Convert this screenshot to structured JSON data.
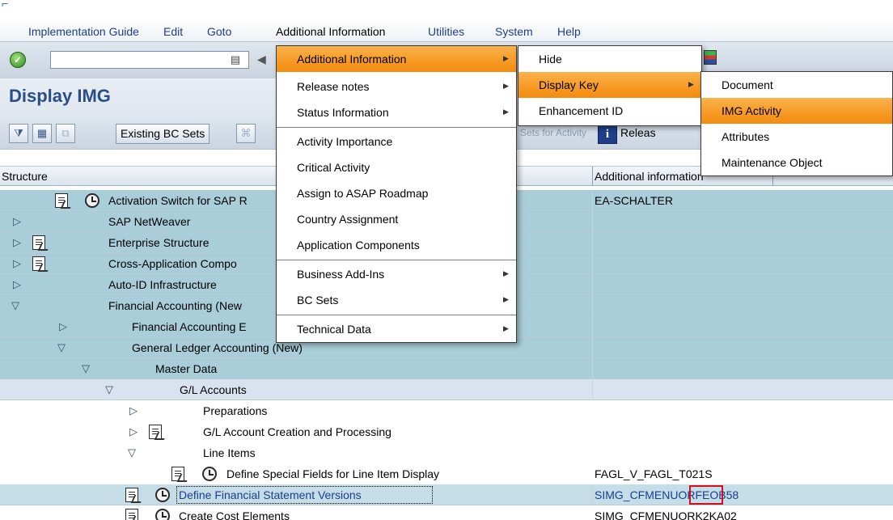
{
  "menubar": {
    "items": [
      "Implementation Guide",
      "Edit",
      "Goto",
      "Additional Information",
      "Utilities",
      "System",
      "Help"
    ]
  },
  "page": {
    "title": "Display IMG"
  },
  "toolbar": {
    "existing_bc_sets": "Existing BC Sets",
    "bc_sets_for_activity": "Sets for Activity",
    "release": "Releas"
  },
  "tree": {
    "col_structure": "Structure",
    "col_info": "Additional information",
    "rows": [
      {
        "label": "Activation Switch for SAP R",
        "info": "EA-SCHALTER"
      },
      {
        "label": "SAP NetWeaver",
        "info": ""
      },
      {
        "label": "Enterprise Structure",
        "info": ""
      },
      {
        "label": "Cross-Application Compo",
        "info": ""
      },
      {
        "label": "Auto-ID Infrastructure",
        "info": ""
      },
      {
        "label": "Financial Accounting (New",
        "info": ""
      },
      {
        "label": "Financial Accounting E",
        "info": ""
      },
      {
        "label": "General Ledger Accounting (New)",
        "info": ""
      },
      {
        "label": "Master Data",
        "info": ""
      },
      {
        "label": "G/L Accounts",
        "info": ""
      },
      {
        "label": "Preparations",
        "info": ""
      },
      {
        "label": "G/L Account Creation and Processing",
        "info": ""
      },
      {
        "label": "Line Items",
        "info": ""
      },
      {
        "label": "Define Special Fields for Line Item Display",
        "info": "FAGL_V_FAGL_T021S"
      },
      {
        "label": "Define Financial Statement Versions",
        "info_prefix": "SIMG_CFMENUORFE",
        "info_highlight": "OB58"
      },
      {
        "label": "Create Cost Elements",
        "info": "SIMG_CFMENUORK2KA02"
      }
    ]
  },
  "menu_additional_info": {
    "items": [
      "Additional Information",
      "Release notes",
      "Status Information",
      "Activity Importance",
      "Critical Activity",
      "Assign to ASAP Roadmap",
      "Country Assignment",
      "Application Components",
      "Business Add-Ins",
      "BC Sets",
      "Technical Data"
    ]
  },
  "submenu_additional_info": {
    "items": [
      "Hide",
      "Display Key",
      "Enhancement ID"
    ]
  },
  "submenu_display_key": {
    "items": [
      "Document",
      "IMG Activity",
      "Attributes",
      "Maintenance Object"
    ]
  }
}
